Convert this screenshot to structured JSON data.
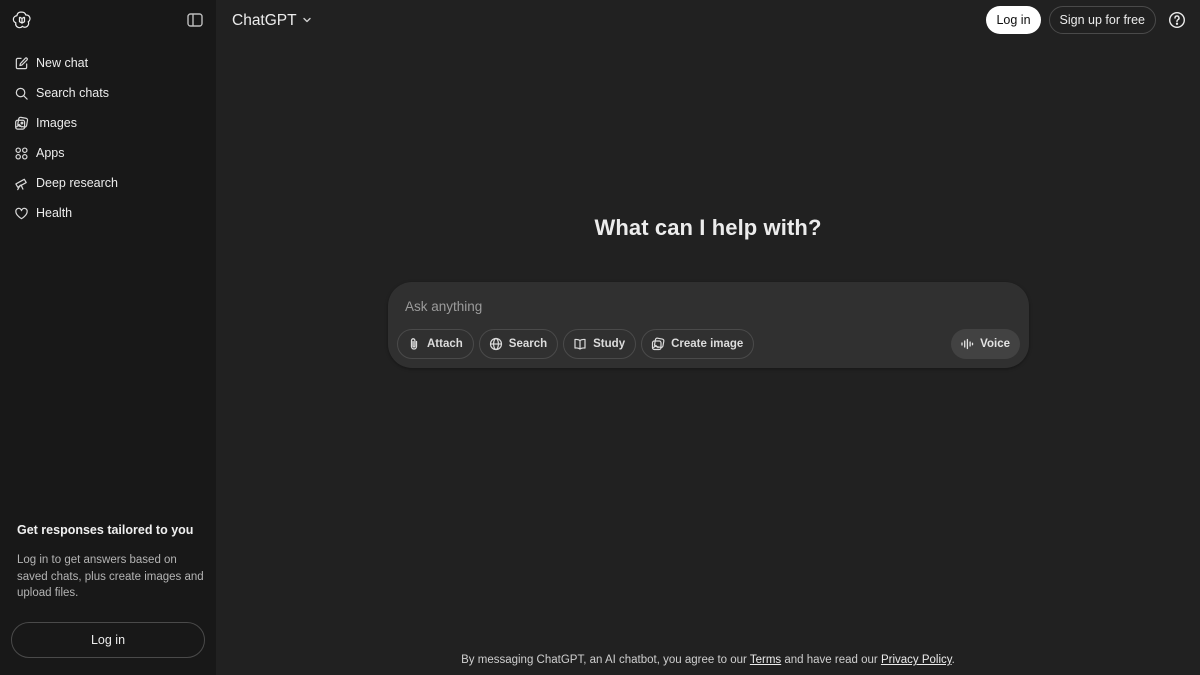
{
  "sidebar": {
    "items": [
      {
        "label": "New chat",
        "icon": "pencil-icon"
      },
      {
        "label": "Search chats",
        "icon": "search-icon"
      },
      {
        "label": "Images",
        "icon": "images-icon"
      },
      {
        "label": "Apps",
        "icon": "apps-icon"
      },
      {
        "label": "Deep research",
        "icon": "telescope-icon"
      },
      {
        "label": "Health",
        "icon": "heart-icon"
      }
    ],
    "promo": {
      "title": "Get responses tailored to you",
      "text": "Log in to get answers based on saved chats, plus create images and upload files."
    },
    "login_label": "Log in"
  },
  "header": {
    "model_name": "ChatGPT",
    "login_label": "Log in",
    "signup_label": "Sign up for free"
  },
  "main": {
    "headline": "What can I help with?",
    "composer": {
      "placeholder": "Ask anything",
      "tools": [
        {
          "label": "Attach",
          "icon": "paperclip-icon"
        },
        {
          "label": "Search",
          "icon": "globe-icon"
        },
        {
          "label": "Study",
          "icon": "book-icon"
        },
        {
          "label": "Create image",
          "icon": "image-create-icon"
        }
      ],
      "voice_label": "Voice"
    },
    "disclaimer": {
      "prefix": "By messaging ChatGPT, an AI chatbot, you agree to our ",
      "terms": "Terms",
      "middle": " and have read our ",
      "privacy": "Privacy Policy",
      "suffix": "."
    }
  },
  "colors": {
    "background": "#212121",
    "sidebar": "#181818",
    "composer": "#303030"
  }
}
